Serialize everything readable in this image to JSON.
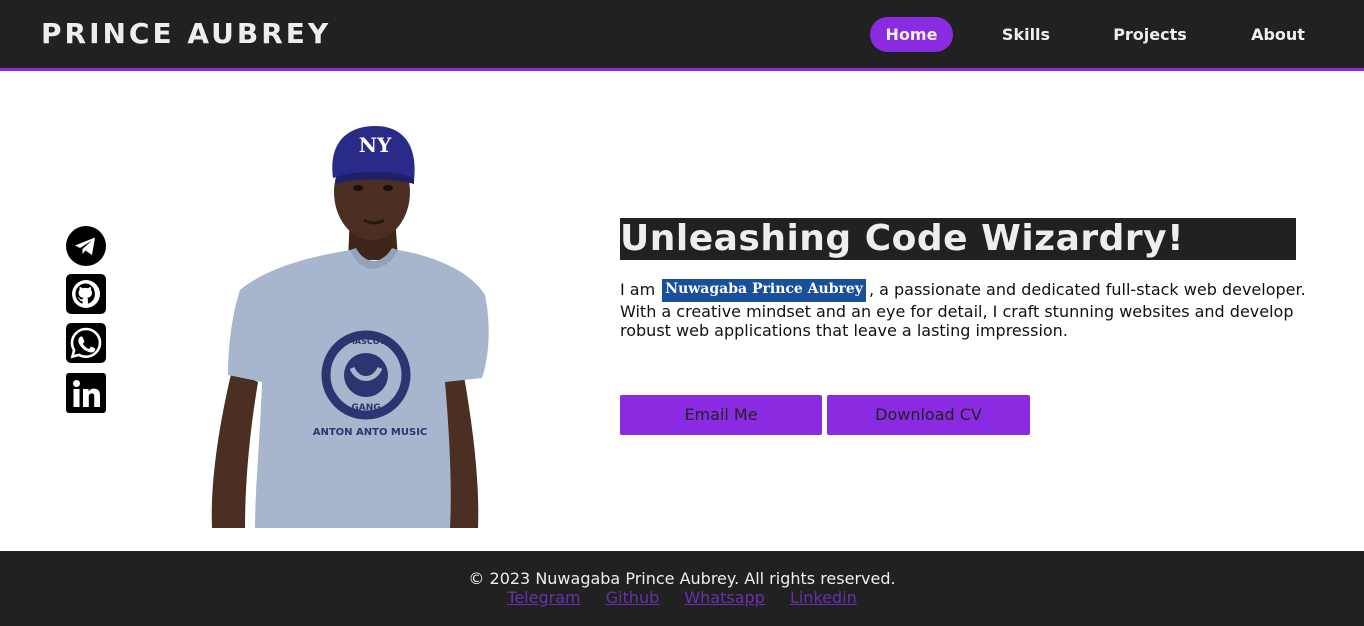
{
  "header": {
    "brand": "PRINCE AUBREY",
    "nav": [
      {
        "label": "Home",
        "active": true
      },
      {
        "label": "Skills",
        "active": false
      },
      {
        "label": "Projects",
        "active": false
      },
      {
        "label": "About",
        "active": false
      }
    ]
  },
  "social": [
    {
      "icon": "telegram-icon"
    },
    {
      "icon": "github-icon"
    },
    {
      "icon": "whatsapp-icon"
    },
    {
      "icon": "linkedin-icon"
    }
  ],
  "portrait": {
    "cap_text": "NY",
    "shirt_logo_top": "MASCOT",
    "shirt_logo_bottom": "GANG",
    "shirt_text": "ANTON ANTO MUSIC"
  },
  "hero": {
    "headline": "Unleashing Code Wizardry!",
    "intro_prefix": "I am",
    "name": "Nuwagaba Prince Aubrey",
    "intro_suffix": ", a passionate and dedicated full-stack web developer.",
    "intro_rest": "With a creative mindset and an eye for detail, I craft stunning websites and develop robust web applications that leave a lasting impression.",
    "email_button": "Email Me",
    "cv_button": "Download CV"
  },
  "footer": {
    "copyright": "© 2023 Nuwagaba Prince Aubrey. All rights reserved.",
    "links": [
      "Telegram",
      "Github",
      "Whatsapp",
      "Linkedin"
    ]
  },
  "colors": {
    "accent": "#8a2be2",
    "dark": "#212121",
    "highlight": "#1a4f9c"
  }
}
